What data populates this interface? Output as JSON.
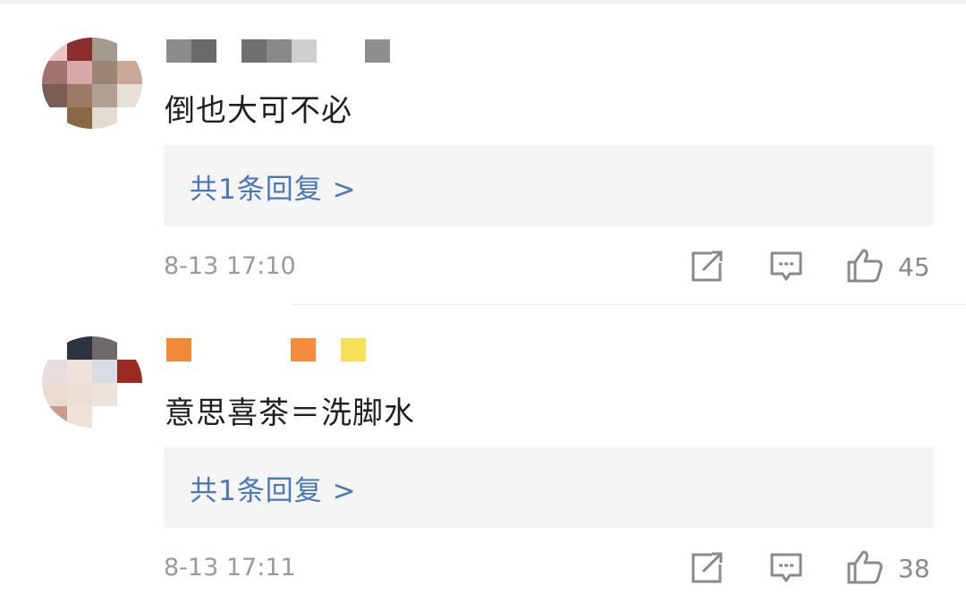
{
  "comments": [
    {
      "text": "倒也大可不必",
      "reply_label": "共1条回复 >",
      "time": "8-13 17:10",
      "likes": "45",
      "avatar_colors": [
        "#e8c4c4",
        "#8a2d2d",
        "#a59a8e",
        "#ffffff",
        "#a0746e",
        "#d8a8a8",
        "#9a8474",
        "#c8a894",
        "#7a5e52",
        "#9c7c68",
        "#b4a090",
        "#e6e0d8",
        "#ffffff",
        "#8a6a44",
        "#e4dcd2",
        "#ffffff"
      ],
      "name_colors": [
        "#8c8c8c",
        "#6a6a6a",
        "#707070",
        "#8a8a8a",
        "#cfcfcf",
        "#8e8e8e"
      ]
    },
    {
      "text": "意思喜茶＝洗脚水",
      "reply_label": "共1条回复 >",
      "time": "8-13 17:11",
      "likes": "38",
      "avatar_colors": [
        "#ffffff",
        "#2d3440",
        "#6f6a6a",
        "#ffffff",
        "#e6dede",
        "#efe2d8",
        "#d8dde4",
        "#9c2a22",
        "#eadad0",
        "#ece0d4",
        "#ece4dc",
        "#ffffff",
        "#c89a90",
        "#efe2d8",
        "#ffffff",
        "#ffffff"
      ],
      "name_colors": [
        "#f08a3a",
        "#f48b3d",
        "#f8e05a"
      ]
    }
  ],
  "icons": {
    "share": "share-icon",
    "comment": "comment-icon",
    "like": "thumbs-up-icon"
  }
}
